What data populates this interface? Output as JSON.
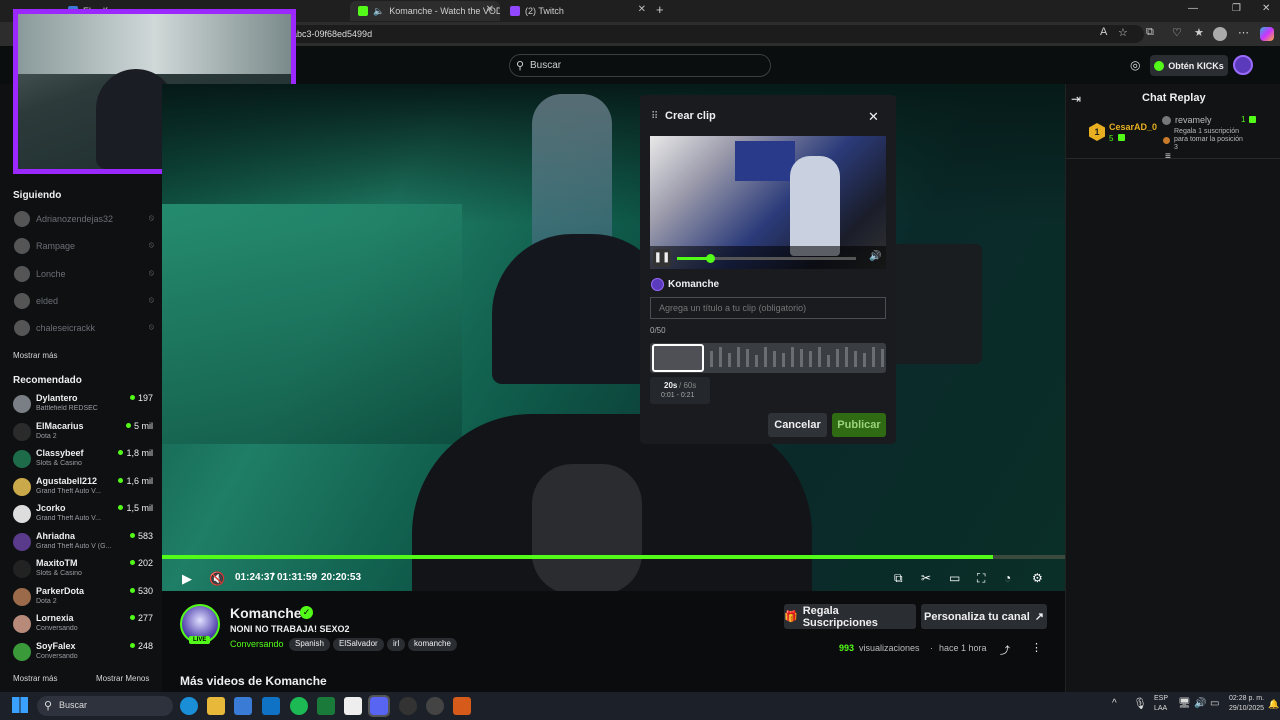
{
  "browser": {
    "tabs": [
      {
        "label": "El sulfuro",
        "color": "#3a7bd5"
      },
      {
        "label": "Komanche - Watch the VOD",
        "color": "#53fc18"
      },
      {
        "label": "(2) Twitch",
        "color": "#9146ff"
      }
    ],
    "url": "abc3-09f68ed5499d"
  },
  "header": {
    "search_placeholder": "Buscar",
    "kicks_label": "Obtén KICKs"
  },
  "sidebar": {
    "following_title": "Siguiendo",
    "following": [
      {
        "name": "Adrianozendejas32"
      },
      {
        "name": "Rampage"
      },
      {
        "name": "Lonche"
      },
      {
        "name": "elded"
      },
      {
        "name": "chaleseicrackk"
      }
    ],
    "show_more": "Mostrar más",
    "recommended_title": "Recomendado",
    "recommended": [
      {
        "name": "Dylantero",
        "category": "Battlefield REDSEC",
        "viewers": "197",
        "color": "#7a7f86"
      },
      {
        "name": "ElMacarius",
        "category": "Dota 2",
        "viewers": "5 mil",
        "color": "#2b2b2b"
      },
      {
        "name": "Classybeef",
        "category": "Slots & Casino",
        "viewers": "1,8 mil",
        "color": "#1e6b4a"
      },
      {
        "name": "Agustabell212",
        "category": "Grand Theft Auto V...",
        "viewers": "1,6 mil",
        "color": "#c9a94a"
      },
      {
        "name": "Jcorko",
        "category": "Grand Theft Auto V...",
        "viewers": "1,5 mil",
        "color": "#ddd"
      },
      {
        "name": "Ahriadna",
        "category": "Grand Theft Auto V (G...",
        "viewers": "583",
        "color": "#5a3a8a"
      },
      {
        "name": "MaxitoTM",
        "category": "Slots & Casino",
        "viewers": "202",
        "color": "#222"
      },
      {
        "name": "ParkerDota",
        "category": "Dota 2",
        "viewers": "530",
        "color": "#9a6a4a"
      },
      {
        "name": "Lornexia",
        "category": "Conversando",
        "viewers": "277",
        "color": "#b88a7a"
      },
      {
        "name": "SoyFalex",
        "category": "Conversando",
        "viewers": "248",
        "color": "#3a9a3a"
      }
    ],
    "show_more_bottom": "Mostrar más",
    "show_less": "Mostrar Menos"
  },
  "player": {
    "time_current": "01:24:37",
    "time_separator": "/",
    "time_total": "01:31:59",
    "clock": "20:20:53",
    "progress": 0.92
  },
  "clip_modal": {
    "title": "Crear clip",
    "channel": "Komanche",
    "title_placeholder": "Agrega un título a tu clip (obligatorio)",
    "char_count": "0/50",
    "duration": "20s",
    "duration_max": "/ 60s",
    "range": "0:01 - 0:21",
    "cancel": "Cancelar",
    "publish": "Publicar"
  },
  "chat": {
    "title": "Chat Replay",
    "message": {
      "user": "CesarAD_0",
      "count": "5",
      "gifter": "revamely",
      "gifter_count": "1",
      "text1": "Regala 1 suscripción",
      "text2": "para tomar la posición",
      "position": "3"
    }
  },
  "stream": {
    "channel": "Komanche",
    "live_badge": "LIVE",
    "title": "NONI NO TRABAJA! SEXO2",
    "category": "Conversando",
    "tags": [
      "Spanish",
      "ElSalvador",
      "irl",
      "komanche"
    ],
    "gift_subs": "Regala Suscripciones",
    "customize": "Personaliza tu canal",
    "views_count": "993",
    "views_label": "visualizaciones",
    "time_ago": "hace 1 hora",
    "more_videos": "Más videos de Komanche"
  },
  "taskbar": {
    "search": "Buscar",
    "lang1": "ESP",
    "lang2": "LAA",
    "time": "02:28 p. m.",
    "date": "29/10/2025"
  },
  "colors": {
    "accent": "#53fc18",
    "pip_border": "#9b28ff"
  }
}
